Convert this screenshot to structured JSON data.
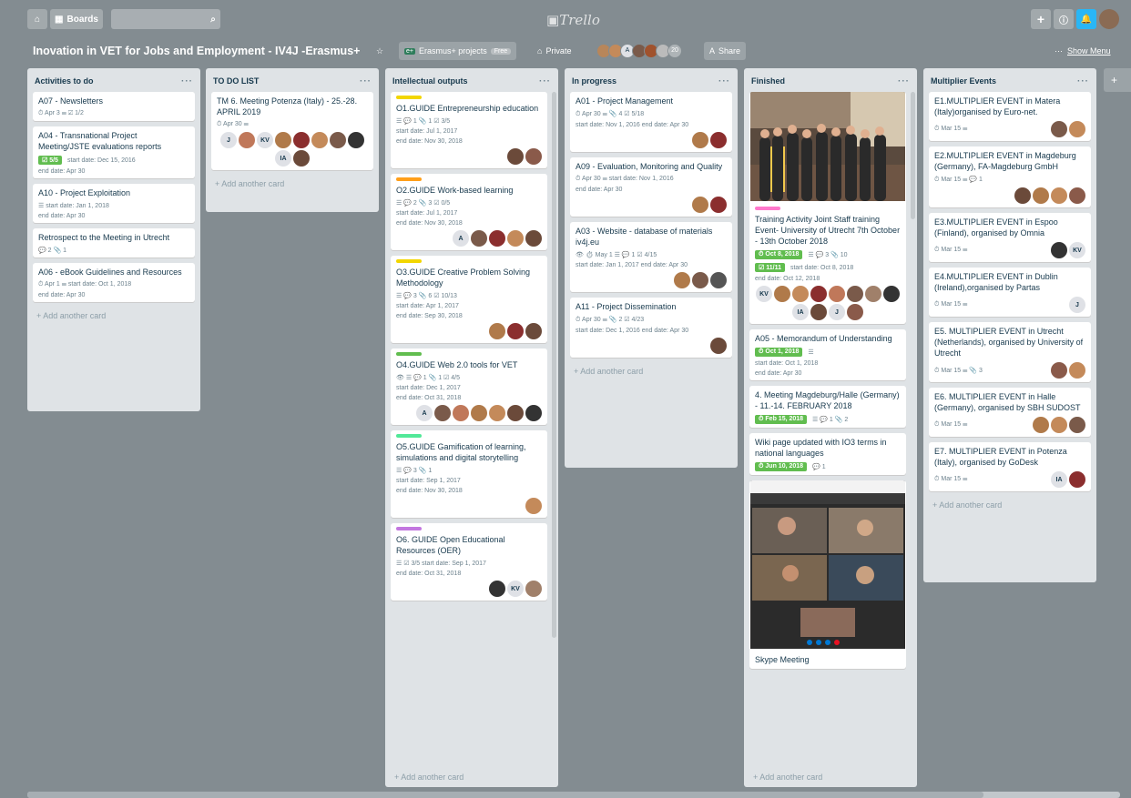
{
  "topbar": {
    "boards_label": "Boards",
    "logo": "Trello"
  },
  "board": {
    "title": "Inovation in VET for Jobs and Employment - IV4J -Erasmus+",
    "team_label": "Erasmus+ projects",
    "team_badge": "Free",
    "visibility": "Private",
    "member_count": "20",
    "share_label": "Share",
    "show_menu": "Show Menu"
  },
  "lists": [
    {
      "title": "Activities to do",
      "add": "+ Add another card",
      "cards": [
        {
          "title": "A07 - Newsletters",
          "meta": "⏱ Apr 3   ☰   ☑ 1/2"
        },
        {
          "title": "A04 - Transnational Project Meeting/JSTE evaluations reports",
          "badge": "☑ 5/5",
          "meta": "start date: Dec 15, 2016",
          "end": "end date: Apr 30"
        },
        {
          "title": "A10 - Project Exploitation",
          "meta": "☰   start date: Jan 1, 2018",
          "end": "end date: Apr 30"
        },
        {
          "title": "Retrospect to the Meeting in Utrecht",
          "meta": "💬 2   📎 1"
        },
        {
          "title": "A06 - eBook Guidelines and Resources",
          "meta": "⏱ Apr 1   ☰   start date: Oct 1, 2018",
          "end": "end date: Apr 30"
        }
      ]
    },
    {
      "title": "TO DO LIST",
      "add": "+ Add another card",
      "cards": [
        {
          "title": "TM 6. Meeting Potenza (Italy) - 25.-28. APRIL 2019",
          "meta": "⏱ Apr 30   ☰",
          "avatars": [
            "J",
            "#c0785a",
            "KV",
            "#b07a4a",
            "#8b2e2e",
            "#c48a5a",
            "#7a5a4a",
            "#333",
            "IA",
            "#6b4a3a"
          ]
        }
      ]
    },
    {
      "title": "Intellectual outputs",
      "add": "+ Add another card",
      "cards": [
        {
          "label": "#f2d600",
          "title": "O1.GUIDE Entrepreneurship education",
          "meta": "☰   💬 1   📎 1   ☑ 3/5",
          "start": "start date: Jul 1, 2017",
          "end": "end date: Nov 30, 2018"
        },
        {
          "label": "#ff9f1a",
          "title": "O2.GUIDE Work-based learning",
          "meta": "☰   💬 2   📎 3   ☑ 0/5",
          "start": "start date: Jul 1, 2017",
          "end": "end date: Nov 30, 2018"
        },
        {
          "label": "#f2d600",
          "title": "O3.GUIDE Creative Problem Solving Methodology",
          "meta": "☰   💬 3   📎 6   ☑ 10/13",
          "start": "start date: Apr 1, 2017",
          "end": "end date: Sep 30, 2018"
        },
        {
          "label": "#61bd4f",
          "title": "O4.GUIDE Web 2.0 tools for VET",
          "meta": "👁   ☰   💬 1   📎 1   ☑ 4/5",
          "start": "start date: Dec 1, 2017",
          "end": "end date: Oct 31, 2018"
        },
        {
          "label": "#51e898",
          "title": "O5.GUIDE Gamification of learning, simulations and digital storytelling",
          "meta": "☰   💬 3   📎 1",
          "start": "start date: Sep 1, 2017",
          "end": "end date: Nov 30, 2018"
        },
        {
          "label": "#c377e0",
          "title": "O6. GUIDE Open Educational Resources (OER)",
          "meta": "☰   ☑ 3/5   start date: Sep 1, 2017",
          "end": "end date: Oct 31, 2018"
        }
      ]
    },
    {
      "title": "In progress",
      "add": "+ Add another card",
      "cards": [
        {
          "title": "A01 - Project Management",
          "meta": "⏱ Apr 30   ☰   📎 4   ☑ 5/18",
          "start": "start date: Nov 1, 2016   end date: Apr 30"
        },
        {
          "title": "A09 - Evaluation, Monitoring and Quality",
          "meta": "⏱ Apr 30   ☰   start date: Nov 1, 2016",
          "end": "end date: Apr 30"
        },
        {
          "title": "A03 - Website - database of materials iv4j.eu",
          "meta": "👁   ⏱ May 1   ☰   💬 1   ☑ 4/15",
          "start": "start date: Jan 1, 2017   end date: Apr 30"
        },
        {
          "title": "A11 - Project Dissemination",
          "meta": "⏱ Apr 30   ☰   📎 2   ☑ 4/23",
          "start": "start date: Dec 1, 2016   end date: Apr 30"
        }
      ]
    },
    {
      "title": "Finished",
      "add": "+ Add another card",
      "cards": [
        {
          "title": "Training Activity Joint Staff training Event- University of Utrecht 7th October - 13th October 2018",
          "due": "⏱ Oct 8, 2018",
          "meta": "☰   💬 3   📎 10",
          "badge": "☑ 11/11",
          "start": "start date: Oct 8, 2018",
          "end": "end date: Oct 12, 2018"
        },
        {
          "title": "A05 - Memorandum of Understanding",
          "due": "⏱ Oct 1, 2018",
          "meta": "☰",
          "start": "start date: Oct 1, 2018",
          "end": "end date: Apr 30"
        },
        {
          "title": "4. Meeting Magdeburg/Halle (Germany) - 11.-14. FEBRUARY 2018",
          "due": "⏱ Feb 15, 2018",
          "meta": "☰   💬 1   📎 2"
        },
        {
          "title": "Wiki page updated with IO3 terms in national languages",
          "due": "⏱ Jun 10, 2018",
          "meta": "💬 1"
        },
        {
          "title": "Skype Meeting"
        }
      ]
    },
    {
      "title": "Multiplier Events",
      "add": "+ Add another card",
      "cards": [
        {
          "title": "E1.MULTIPLIER EVENT in Matera (Italy)organised by Euro-net.",
          "meta": "⏱ Mar 15   ☰"
        },
        {
          "title": "E2.MULTIPLIER EVENT in Magdeburg (Germany), FA-Magdeburg GmbH",
          "meta": "⏱ Mar 15   ☰   💬 1"
        },
        {
          "title": "E3.MULTIPLIER EVENT in Espoo (Finland), organised by Omnia",
          "meta": "⏱ Mar 15   ☰"
        },
        {
          "title": "E4.MULTIPLIER EVENT in Dublin (Ireland),organised by Partas",
          "meta": "⏱ Mar 15   ☰"
        },
        {
          "title": "E5. MULTIPLIER EVENT in Utrecht (Netherlands), organised by University of Utrecht",
          "meta": "⏱ Mar 15   ☰   📎 3"
        },
        {
          "title": "E6. MULTIPLIER EVENT in Halle (Germany), organised by SBH SUDOST",
          "meta": "⏱ Mar 15   ☰"
        },
        {
          "title": "E7. MULTIPLIER EVENT in Potenza (Italy), organised by GoDesk",
          "meta": "⏱ Mar 15   ☰"
        }
      ]
    }
  ]
}
